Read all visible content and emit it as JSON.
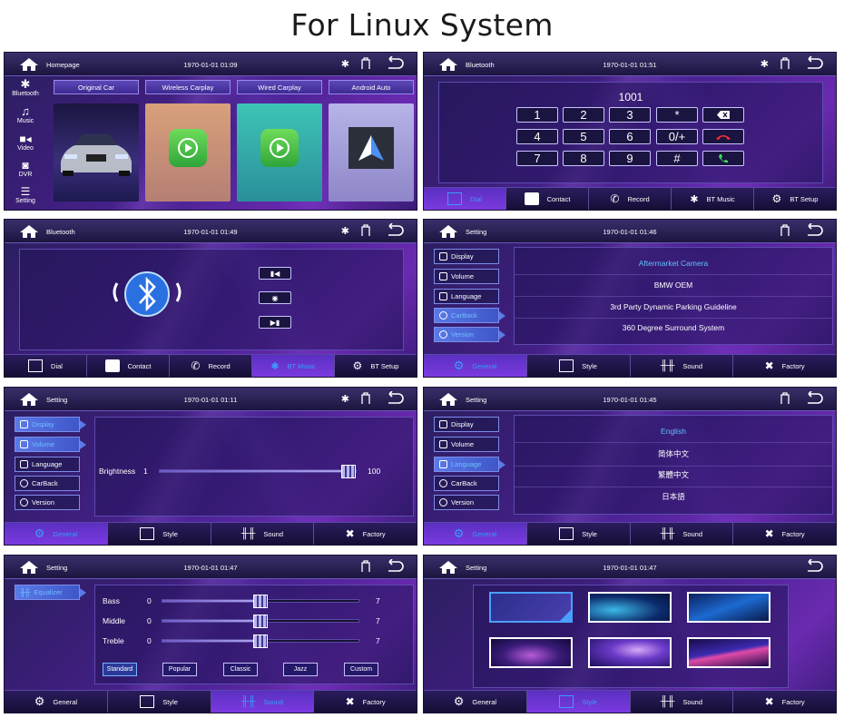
{
  "page_title": "For  Linux System",
  "panel_home": {
    "title": "Homepage",
    "time": "1970-01-01 01:09",
    "sidebar": [
      {
        "label": "Bluetooth",
        "icon": "bluetooth-icon"
      },
      {
        "label": "Music",
        "icon": "music-icon"
      },
      {
        "label": "Video",
        "icon": "video-icon"
      },
      {
        "label": "DVR",
        "icon": "camera-icon"
      },
      {
        "label": "Setting",
        "icon": "settings-icon"
      }
    ],
    "tiles": [
      "Original Car",
      "Wireless Carplay",
      "Wired Carplay",
      "Android Auto"
    ]
  },
  "panel_dial": {
    "title": "Bluetooth",
    "time": "1970-01-01 01:51",
    "number": "1001",
    "keys": [
      "1",
      "2",
      "3",
      "*",
      "4",
      "5",
      "6",
      "0/+",
      "7",
      "8",
      "9",
      "#"
    ],
    "nav": [
      "Dial",
      "Contact",
      "Record",
      "BT Music",
      "BT Setup"
    ]
  },
  "panel_btmusic": {
    "title": "Bluetooth",
    "time": "1970-01-01 01:49",
    "nav": [
      "Dial",
      "Contact",
      "Record",
      "BT Music",
      "BT Setup"
    ]
  },
  "settings_menu": [
    "Display",
    "Volume",
    "Language",
    "CarBack",
    "Version"
  ],
  "settings_nav": [
    "General",
    "Style",
    "Sound",
    "Factory"
  ],
  "panel_carback": {
    "title": "Setting",
    "time": "1970-01-01 01:46",
    "options": [
      "Aftermarket Camera",
      "BMW OEM",
      "3rd Party Dynamic Parking Guideline",
      "360 Degree Surround System"
    ]
  },
  "panel_display": {
    "title": "Setting",
    "time": "1970-01-01 01:11",
    "brightness_label": "Brightness",
    "min": "1",
    "max": "100",
    "brightness_level": 100
  },
  "panel_language": {
    "title": "Setting",
    "time": "1970-01-01 01:45",
    "options": [
      "English",
      "简体中文",
      "繁體中文",
      "日本語"
    ]
  },
  "panel_sound": {
    "title": "Setting",
    "time": "1970-01-01 01:47",
    "menu": "Equalizer",
    "bands": [
      {
        "label": "Bass",
        "min": "0",
        "max": "7",
        "level": 0.5
      },
      {
        "label": "Middle",
        "min": "0",
        "max": "7",
        "level": 0.5
      },
      {
        "label": "Treble",
        "min": "0",
        "max": "7",
        "level": 0.5
      }
    ],
    "presets": [
      "Standard",
      "Popular",
      "Classic",
      "Jazz",
      "Custom"
    ]
  },
  "panel_style": {
    "title": "Setting",
    "time": "1970-01-01 01:47"
  },
  "colors": {
    "accent_blue": "#3a9aff",
    "panel_purple": "#4b2394",
    "status_bar": "#1c1640"
  }
}
